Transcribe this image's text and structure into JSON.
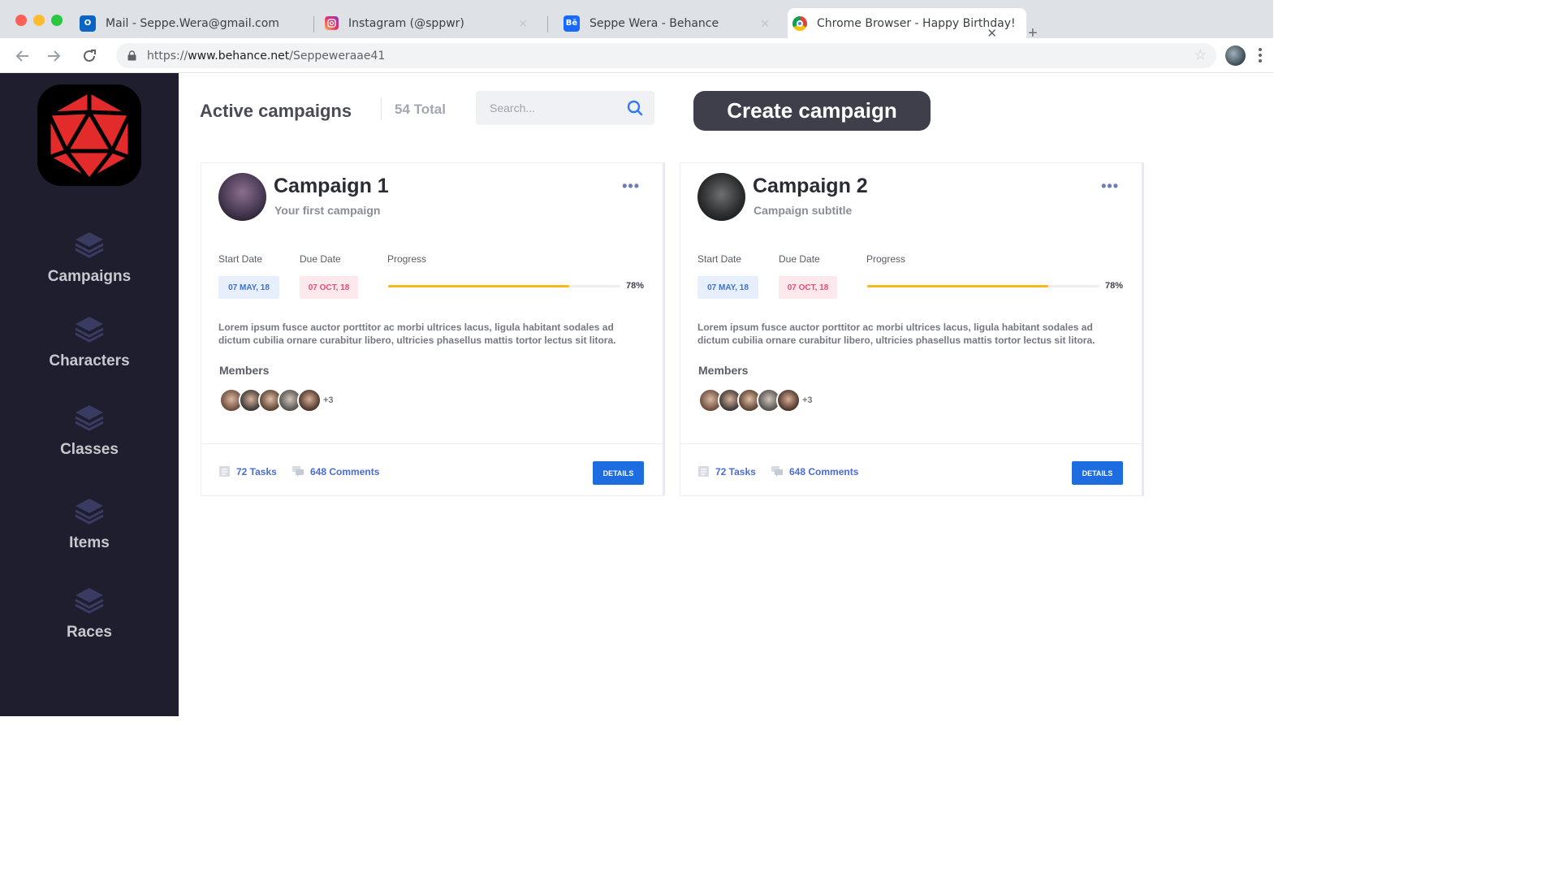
{
  "browser": {
    "tabs": [
      {
        "title": "Mail - Seppe.Wera@gmail.com",
        "icon": "outlook-icon"
      },
      {
        "title": "Instagram (@sppwr)",
        "icon": "instagram-icon"
      },
      {
        "title": "Seppe Wera - Behance",
        "icon": "behance-icon"
      },
      {
        "title": "Chrome Browser - Happy Birthday!",
        "icon": "chrome-icon",
        "active": true
      }
    ],
    "url_prefix": "https://",
    "url_domain": "www.behance.net",
    "url_path": "/Seppeweraae41"
  },
  "sidebar": {
    "items": [
      {
        "label": "Campaigns",
        "icon": "layers-icon"
      },
      {
        "label": "Characters",
        "icon": "layers-icon"
      },
      {
        "label": "Classes",
        "icon": "layers-icon"
      },
      {
        "label": "Items",
        "icon": "layers-icon"
      },
      {
        "label": "Races",
        "icon": "layers-icon"
      }
    ]
  },
  "header": {
    "title": "Active campaigns",
    "total": "54 Total",
    "search_placeholder": "Search...",
    "create_label": "Create campaign"
  },
  "campaigns": [
    {
      "title": "Campaign 1",
      "subtitle": "Your first campaign",
      "start_label": "Start Date",
      "start": "07 MAY, 18",
      "due_label": "Due Date",
      "due": "07 OCT, 18",
      "progress_label": "Progress",
      "progress_text": "78%",
      "progress": 0.78,
      "description": "Lorem ipsum fusce auctor porttitor ac morbi ultrices lacus, ligula habitant sodales ad dictum cubilia ornare curabitur libero, ultricies phasellus mattis tortor lectus sit litora.",
      "members_label": "Members",
      "members_more": "+3",
      "tasks": "72 Tasks",
      "comments": "648 Comments",
      "details_label": "DETAILS"
    },
    {
      "title": "Campaign 2",
      "subtitle": "Campaign subtitle",
      "start_label": "Start Date",
      "start": "07 MAY, 18",
      "due_label": "Due Date",
      "due": "07 OCT, 18",
      "progress_label": "Progress",
      "progress_text": "78%",
      "progress": 0.78,
      "description": "Lorem ipsum fusce auctor porttitor ac morbi ultrices lacus, ligula habitant sodales ad dictum cubilia ornare curabitur libero, ultricies phasellus mattis tortor lectus sit litora.",
      "members_label": "Members",
      "members_more": "+3",
      "tasks": "72 Tasks",
      "comments": "648 Comments",
      "details_label": "DETAILS"
    }
  ],
  "colors": {
    "sidebar_bg": "#1e1e2e",
    "accent_blue": "#1d6de0",
    "progress": "#f5b81f",
    "start_pill_bg": "#e7effc",
    "due_pill_bg": "#fde8ee",
    "logo_red": "#e32b2b"
  }
}
